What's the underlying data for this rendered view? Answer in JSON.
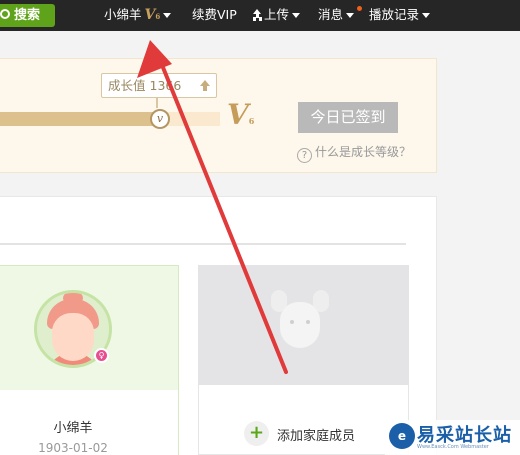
{
  "topbar": {
    "search_label": "搜索",
    "username": "小绵羊",
    "vip_badge": "V",
    "vip_badge_level": "6",
    "renew_vip": "续费VIP",
    "upload": "上传",
    "messages": "消息",
    "history": "播放记录",
    "notify_dot_color": "#f0601a"
  },
  "growth": {
    "tooltip_label": "成长值 1",
    "tooltip_value": "366",
    "progress_fraction": 0.73,
    "knob_icon": "v",
    "level_letter": "V",
    "level_num": "6",
    "signin_button": "今日已签到",
    "help_link": "什么是成长等级？",
    "help_icon_glyph": "?"
  },
  "family": {
    "member": {
      "name": "小绵羊",
      "birthday": "1903-01-02",
      "gender_icon": "female-icon"
    },
    "add_icon_glyph": "+",
    "add_label": "添加家庭成员"
  },
  "watermark": {
    "logo_glyph": "e",
    "text": "易采站长站",
    "url": "Www.Easck.Com Webmaster"
  },
  "colors": {
    "topbar_bg": "#262626",
    "accent_green": "#5ea31a",
    "gold": "#c69c5a",
    "arrow_red": "#e03a3a"
  }
}
